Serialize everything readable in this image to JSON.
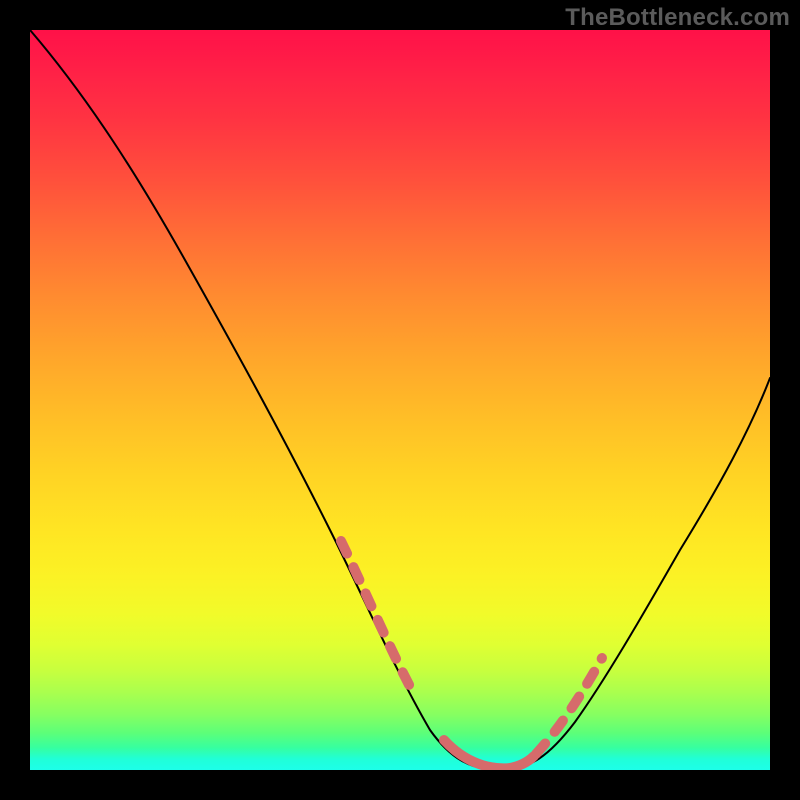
{
  "watermark": "TheBottleneck.com",
  "colors": {
    "background": "#000000",
    "curve": "#000000",
    "marker": "#d66b6b",
    "watermark_text": "#5b5b5b"
  },
  "chart_data": {
    "type": "line",
    "title": "",
    "xlabel": "",
    "ylabel": "",
    "xlim": [
      0,
      100
    ],
    "ylim": [
      0,
      100
    ],
    "grid": false,
    "legend": false,
    "series": [
      {
        "name": "curve",
        "x": [
          0,
          6,
          12,
          18,
          24,
          30,
          36,
          42,
          48,
          52,
          56,
          60,
          64,
          68,
          72,
          76,
          80,
          84,
          88,
          92,
          96,
          100
        ],
        "y": [
          100,
          93,
          84,
          75,
          65,
          54,
          43,
          31,
          18,
          10,
          4,
          1,
          0,
          0.5,
          2,
          6,
          12,
          20,
          29,
          38,
          46,
          53
        ]
      }
    ],
    "markers": {
      "left_dashes": {
        "x_range": [
          42,
          52
        ],
        "note": "coral dashed segment on descending branch"
      },
      "bottom_solid": {
        "x_range": [
          56,
          67
        ],
        "note": "coral solid segment along valley floor"
      },
      "right_dashes": {
        "x_range": [
          67.5,
          77
        ],
        "note": "coral dashed segment on ascending branch"
      }
    },
    "background_gradient": {
      "direction": "vertical",
      "top_color": "#ff1148",
      "mid_color": "#ffe623",
      "bottom_color": "#1dffe9",
      "note": "red at top through orange/yellow to green/cyan at bottom"
    }
  }
}
